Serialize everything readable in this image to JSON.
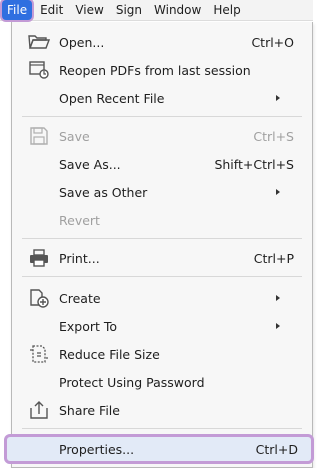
{
  "menubar": {
    "items": [
      {
        "label": "File"
      },
      {
        "label": "Edit"
      },
      {
        "label": "View"
      },
      {
        "label": "Sign"
      },
      {
        "label": "Window"
      },
      {
        "label": "Help"
      }
    ]
  },
  "file_menu": {
    "open": {
      "label": "Open...",
      "shortcut": "Ctrl+O"
    },
    "reopen": {
      "label": "Reopen PDFs from last session"
    },
    "open_recent": {
      "label": "Open Recent File"
    },
    "save": {
      "label": "Save",
      "shortcut": "Ctrl+S"
    },
    "save_as": {
      "label": "Save As...",
      "shortcut": "Shift+Ctrl+S"
    },
    "save_as_other": {
      "label": "Save as Other"
    },
    "revert": {
      "label": "Revert"
    },
    "print": {
      "label": "Print...",
      "shortcut": "Ctrl+P"
    },
    "create": {
      "label": "Create"
    },
    "export_to": {
      "label": "Export To"
    },
    "reduce_size": {
      "label": "Reduce File Size"
    },
    "protect": {
      "label": "Protect Using Password"
    },
    "share": {
      "label": "Share File"
    },
    "properties": {
      "label": "Properties...",
      "shortcut": "Ctrl+D"
    }
  },
  "colors": {
    "highlight_outline": "#c39bd6",
    "active_menu": "#2f6fe0"
  }
}
